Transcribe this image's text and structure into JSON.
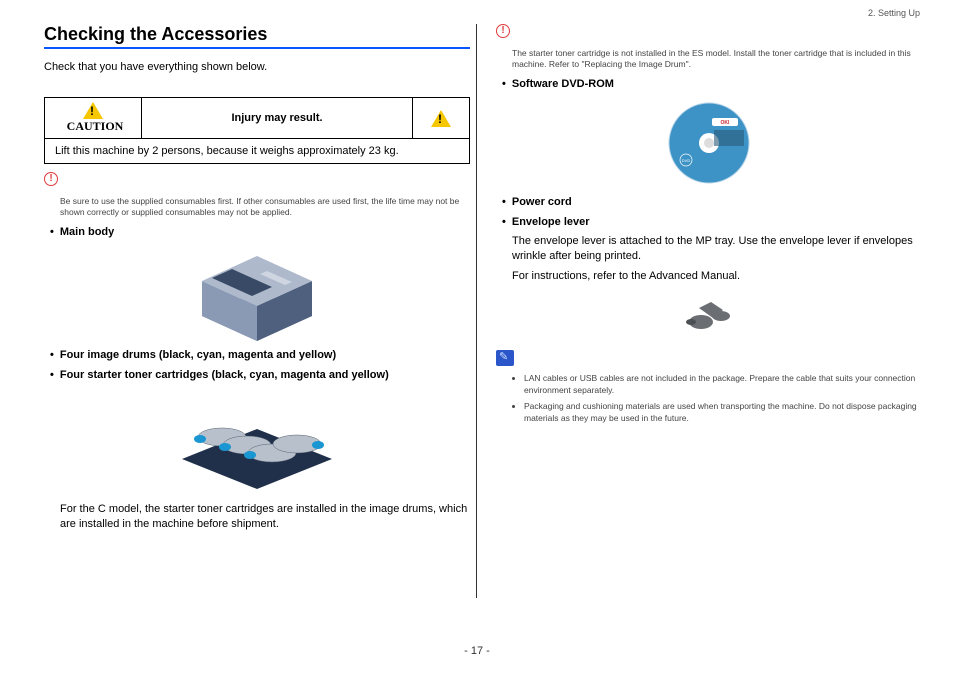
{
  "header_chapter": "2. Setting Up",
  "title": "Checking the Accessories",
  "intro": "Check that you have everything shown below.",
  "caution": {
    "label": "CAUTION",
    "warning": "Injury may result.",
    "body": "Lift this machine by 2 persons, because it weighs approximately 23 kg."
  },
  "left_notice": "Be sure to use the supplied consumables first. If other consumables are used first, the life time may not be shown correctly or supplied consumables may not be applied.",
  "left_items": {
    "main_body": "Main body",
    "image_drums": "Four image drums (black, cyan, magenta and yellow)",
    "toner": "Four starter toner cartridges (black, cyan, magenta and yellow)",
    "c_model_note": "For the C model, the starter toner cartridges are installed in the image drums, which are installed in the machine before shipment."
  },
  "right_notice": "The starter toner cartridge is not installed in the ES model. Install the toner cartridge that is included in this machine. Refer to \"Replacing the Image Drum\".",
  "right_items": {
    "dvd": "Software DVD-ROM",
    "power": "Power cord",
    "envelope": "Envelope lever",
    "envelope_text": "The envelope lever is attached to the MP tray. Use the envelope lever if envelopes wrinkle after being printed.",
    "envelope_ref": "For instructions, refer to the Advanced Manual."
  },
  "memo": {
    "items": [
      "LAN cables or USB cables are not included in the package. Prepare the cable that suits your connection environment separately.",
      "Packaging and cushioning materials are used when transporting the machine. Do not dispose packaging materials as they may be used in the future."
    ]
  },
  "page_number": "- 17 -",
  "dvd_brand": "OKI"
}
